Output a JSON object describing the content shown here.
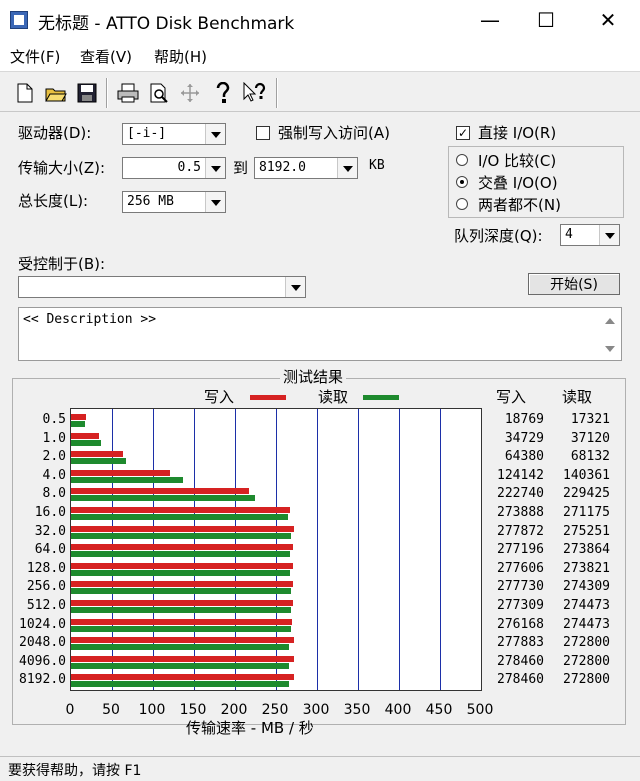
{
  "window": {
    "title": "无标题 - ATTO Disk Benchmark"
  },
  "menu": [
    "文件(F)",
    "查看(V)",
    "帮助(H)"
  ],
  "toolbar_icons": [
    "new-file-icon",
    "open-folder-icon",
    "save-icon",
    "print-icon",
    "print-preview-icon",
    "move-icon",
    "help-icon",
    "context-help-icon"
  ],
  "form": {
    "drive_label": "驱动器(D):",
    "drive_value": "[-i-]",
    "force_write_label": "强制写入访问(A)",
    "force_write_checked": false,
    "direct_io_label": "直接 I/O(R)",
    "direct_io_checked": true,
    "transfer_label": "传输大小(Z):",
    "transfer_from": "0.5",
    "to_label": "到",
    "transfer_to": "8192.0",
    "unit": "KB",
    "io_compare_label": "I/O 比较(C)",
    "overlapped_io_label": "交叠 I/O(O)",
    "neither_label": "两者都不(N)",
    "selected_mode": "交叠 I/O(O)",
    "length_label": "总长度(L):",
    "length_value": "256 MB",
    "queue_label": "队列深度(Q):",
    "queue_value": "4",
    "controlled_by_label": "受控制于(B):",
    "controlled_by_value": "",
    "start_button": "开始(S)",
    "description": "<< Description >>"
  },
  "results": {
    "title": "测试结果",
    "write_label": "写入",
    "read_label": "读取",
    "write_col": "写入",
    "read_col": "读取",
    "x_axis_label": "传输速率 - MB / 秒",
    "colors": {
      "write": "#d62222",
      "read": "#1e8a2e",
      "grid": "#1c2fa8"
    }
  },
  "chart_data": {
    "type": "bar",
    "orientation": "horizontal",
    "categories": [
      "0.5",
      "1.0",
      "2.0",
      "4.0",
      "8.0",
      "16.0",
      "32.0",
      "64.0",
      "128.0",
      "256.0",
      "512.0",
      "1024.0",
      "2048.0",
      "4096.0",
      "8192.0"
    ],
    "series": [
      {
        "name": "写入",
        "values": [
          18769,
          34729,
          64380,
          124142,
          222740,
          273888,
          277872,
          277196,
          277606,
          277730,
          277309,
          276168,
          277883,
          278460,
          278460
        ]
      },
      {
        "name": "读取",
        "values": [
          17321,
          37120,
          68132,
          140361,
          229425,
          271175,
          275251,
          273864,
          273821,
          274309,
          274473,
          274473,
          272800,
          272800,
          272800
        ]
      }
    ],
    "xlabel": "传输速率 - MB / 秒",
    "xlim": [
      0,
      500
    ],
    "xticks": [
      0,
      50,
      100,
      150,
      200,
      250,
      300,
      350,
      400,
      450,
      500
    ],
    "grid": true,
    "legend": "top"
  },
  "status": {
    "text": "要获得帮助，请按 F1"
  }
}
